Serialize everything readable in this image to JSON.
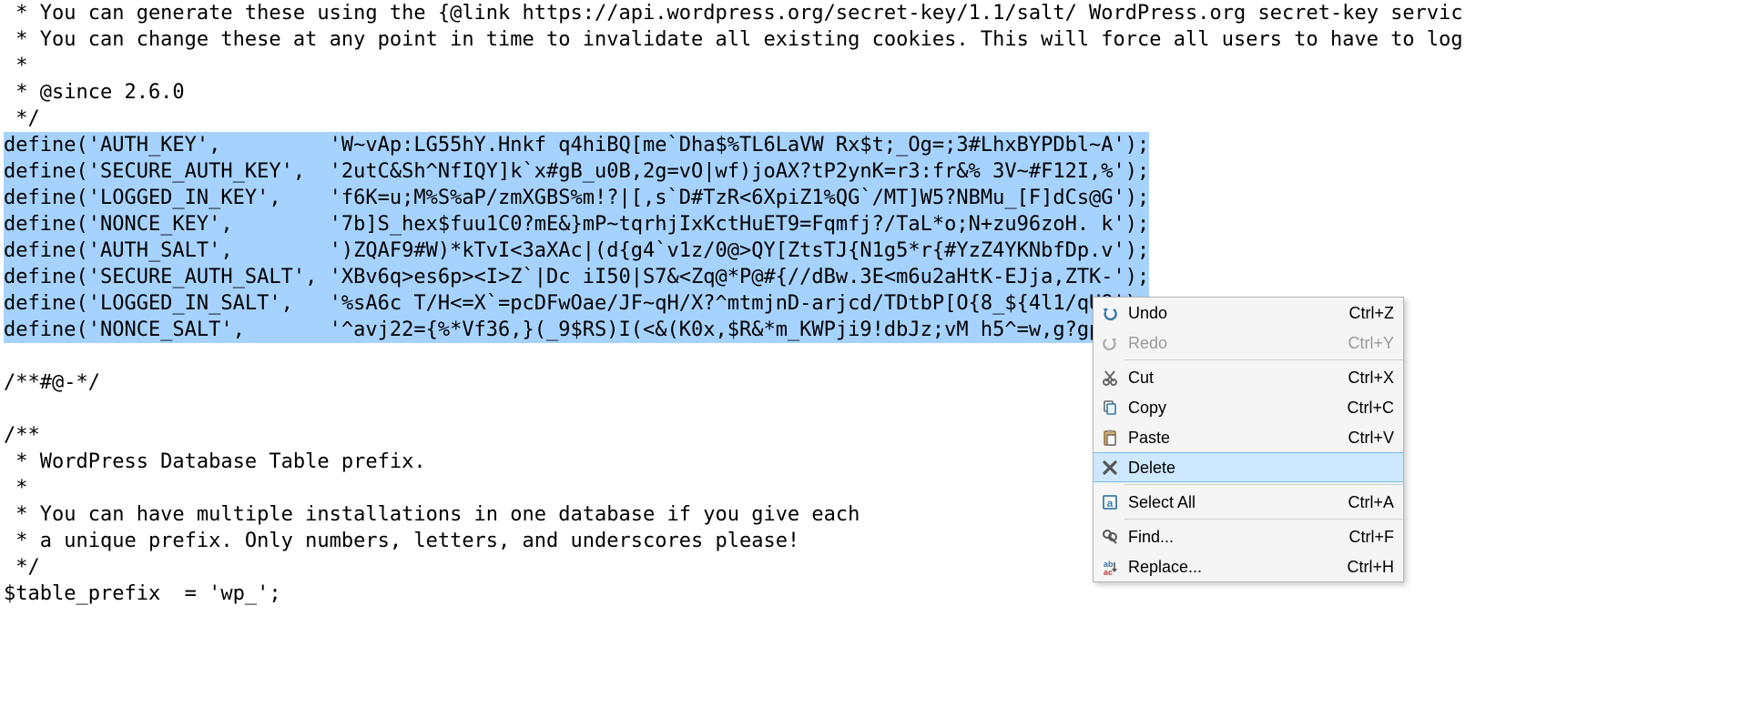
{
  "code": {
    "plain_top": [
      " * You can generate these using the {@link https://api.wordpress.org/secret-key/1.1/salt/ WordPress.org secret-key servic",
      " * You can change these at any point in time to invalidate all existing cookies. This will force all users to have to log",
      " *",
      " * @since 2.6.0",
      " */"
    ],
    "selected": [
      "define('AUTH_KEY',         'W~vAp:LG55hY.Hnkf q4hiBQ[me`Dha$%TL6LaVW Rx$t;_Og=;3#LhxBYPDbl~A');",
      "define('SECURE_AUTH_KEY',  '2utC&Sh^NfIQY]k`x#gB_u0B,2g=vO|wf)joAX?tP2ynK=r3:fr&% 3V~#F12I,%');",
      "define('LOGGED_IN_KEY',    'f6K=u;M%S%aP/zmXGBS%m!?|[,s`D#TzR<6XpiZ1%QG`/MT]W5?NBMu_[F]dCs@G');",
      "define('NONCE_KEY',        '7b]S_hex$fuu1C0?mE&}mP~tqrhjIxKctHuET9=Fqmfj?/TaL*o;N+zu96zoH. k');",
      "define('AUTH_SALT',        ')ZQAF9#W)*kTvI<3aXAc|(d{g4`v1z/0@>QY[ZtsTJ{N1g5*r{#YzZ4YKNbfDp.v');",
      "define('SECURE_AUTH_SALT', 'XBv6q>es6p><I>Z`|Dc iI50|S7&<Zq@*P@#{//dBw.3E<m6u2aHtK-EJja,ZTK-');",
      "define('LOGGED_IN_SALT',   '%sA6c T/H<=X`=pcDFwOae/JF~qH/X?^mtmjnD-arjcd/TDtbP[O{8_${4l1/qU8');",
      "define('NONCE_SALT',       '^avj22={%*Vf36,}(_9$RS)I(<&(K0x,$R&*m_KWPji9!dbJz;vM h5^=w,g?gp,'"
    ],
    "plain_bottom": [
      "",
      "/**#@-*/",
      "",
      "/**",
      " * WordPress Database Table prefix.",
      " *",
      " * You can have multiple installations in one database if you give each",
      " * a unique prefix. Only numbers, letters, and underscores please!",
      " */",
      "$table_prefix  = 'wp_';"
    ]
  },
  "context_menu": {
    "items": [
      {
        "id": "undo",
        "label": "Undo",
        "shortcut": "Ctrl+Z",
        "icon": "undo-icon",
        "disabled": false,
        "hover": false
      },
      {
        "id": "redo",
        "label": "Redo",
        "shortcut": "Ctrl+Y",
        "icon": "redo-icon",
        "disabled": true,
        "hover": false
      },
      {
        "sep": true
      },
      {
        "id": "cut",
        "label": "Cut",
        "shortcut": "Ctrl+X",
        "icon": "cut-icon",
        "disabled": false,
        "hover": false
      },
      {
        "id": "copy",
        "label": "Copy",
        "shortcut": "Ctrl+C",
        "icon": "copy-icon",
        "disabled": false,
        "hover": false
      },
      {
        "id": "paste",
        "label": "Paste",
        "shortcut": "Ctrl+V",
        "icon": "paste-icon",
        "disabled": false,
        "hover": false
      },
      {
        "id": "delete",
        "label": "Delete",
        "shortcut": "",
        "icon": "delete-icon",
        "disabled": false,
        "hover": true
      },
      {
        "sep": true
      },
      {
        "id": "selectall",
        "label": "Select All",
        "shortcut": "Ctrl+A",
        "icon": "select-all-icon",
        "disabled": false,
        "hover": false
      },
      {
        "sep": true
      },
      {
        "id": "find",
        "label": "Find...",
        "shortcut": "Ctrl+F",
        "icon": "find-icon",
        "disabled": false,
        "hover": false
      },
      {
        "id": "replace",
        "label": "Replace...",
        "shortcut": "Ctrl+H",
        "icon": "replace-icon",
        "disabled": false,
        "hover": false
      }
    ]
  }
}
